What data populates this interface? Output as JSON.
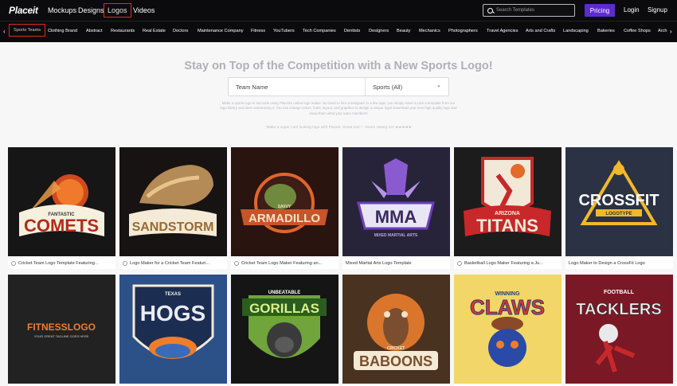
{
  "brand": "Placeit",
  "nav": [
    "Mockups",
    "Designs",
    "Logos",
    "Videos"
  ],
  "search": {
    "placeholder": "Search Templates"
  },
  "pricing": "Pricing",
  "login": "Login",
  "signup": "Signup",
  "categories": [
    "Sports Teams",
    "Clothing Brand",
    "Abstract",
    "Restaurants",
    "Real Estate",
    "Doctors",
    "Maintenance Company",
    "Fitness",
    "YouTubers",
    "Tech Companies",
    "Dentists",
    "Designers",
    "Beauty",
    "Mechanics",
    "Photographers",
    "Travel Agencies",
    "Arts and Crafts",
    "Landscaping",
    "Bakeries",
    "Coffee Shops",
    "Arch"
  ],
  "headline": "Stay on Top of the Competition with a New Sports Logo!",
  "form": {
    "team_placeholder": "Team Name",
    "sport_select": "Sports (All)"
  },
  "description": "Make a sports logo in seconds using Placeit's online logo maker. No need to hire a designer! In a few taps, you simply have to pick a template from our logo library and start customizing it. You can change colors, fonts, layout, and graphics to design a unique logo! Download your new high quality logo and show them what your team members!",
  "quote": "\"Make a super cool looking logo with Placeit. Great tool.\" - Kevin Haney CO ★★★★★",
  "cards": [
    {
      "caption": "Cricket Team Logo Template Featuring...",
      "icon": "play-icon",
      "bg": "#161616",
      "art": "COMETS",
      "sub": "FANTASTIC"
    },
    {
      "caption": "Logo Maker for a Cricket Team Featuri...",
      "icon": "play-icon",
      "bg": "#171312",
      "art": "SANDSTORM",
      "sub": "TEXAS"
    },
    {
      "caption": "Cricket Team Logo Maker Featuring an...",
      "icon": "play-icon",
      "bg": "#2a1410",
      "art": "ARMADILLO",
      "sub": "SAVVY"
    },
    {
      "caption": "Mixed Martial Arts Logo Template",
      "icon": "",
      "bg": "#27243a",
      "art": "MMA",
      "sub": "MIXED MARTIAL ARTS"
    },
    {
      "caption": "Basketball Logo Maker Featuring a Ju...",
      "icon": "play-icon",
      "bg": "#1c1c1c",
      "art": "TITANS",
      "sub": "ARIZONA"
    },
    {
      "caption": "Logo Maker to Design a CrossFit Logo",
      "icon": "",
      "bg": "#2b3244",
      "art": "CROSSFIT",
      "sub": "LOGOTYPE"
    },
    {
      "caption": "",
      "icon": "",
      "bg": "#222222",
      "art": "FITNESSLOGO",
      "sub": "YOUR GREAT TAGLINE GOES HERE"
    },
    {
      "caption": "",
      "icon": "",
      "bg": "#2c5189",
      "art": "HOGS",
      "sub": "TEXAS"
    },
    {
      "caption": "",
      "icon": "",
      "bg": "#151515",
      "art": "GORILLAS",
      "sub": "UNBEATABLE"
    },
    {
      "caption": "",
      "icon": "",
      "bg": "#4a3220",
      "art": "BABOONS",
      "sub": "CRICKET"
    },
    {
      "caption": "",
      "icon": "",
      "bg": "#f2d667",
      "art": "CLAWS",
      "sub": "WINNING"
    },
    {
      "caption": "",
      "icon": "",
      "bg": "#7a1826",
      "art": "TACKLERS",
      "sub": "FOOTBALL"
    }
  ]
}
